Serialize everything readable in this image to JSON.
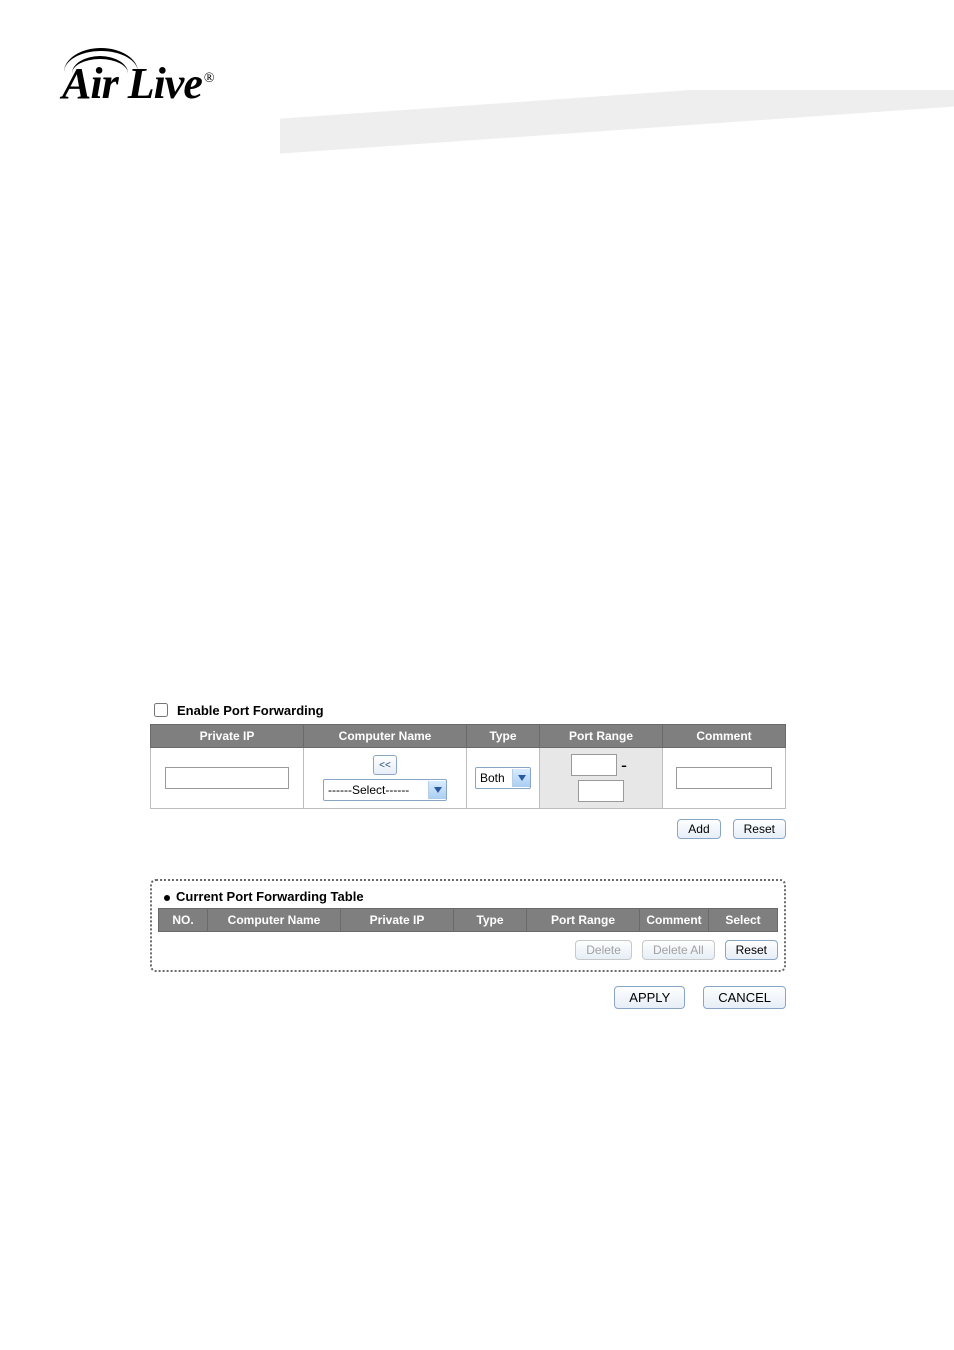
{
  "logo": {
    "text": "Air Live",
    "reg": "®"
  },
  "enable_label": "Enable Port Forwarding",
  "form": {
    "headers": {
      "private_ip": "Private IP",
      "computer_name": "Computer Name",
      "type": "Type",
      "port_range": "Port Range",
      "comment": "Comment"
    },
    "row": {
      "private_ip": "",
      "pick_label": "<<",
      "computer_select_value": "------Select------",
      "type_value": "Both",
      "port_from": "",
      "port_to": "",
      "port_dash": "-",
      "comment": ""
    },
    "buttons": {
      "add": "Add",
      "reset": "Reset"
    }
  },
  "current": {
    "title": "Current Port Forwarding Table",
    "headers": {
      "no": "NO.",
      "computer_name": "Computer Name",
      "private_ip": "Private IP",
      "type": "Type",
      "port_range": "Port Range",
      "comment": "Comment",
      "select": "Select"
    },
    "buttons": {
      "delete": "Delete",
      "delete_all": "Delete All",
      "reset": "Reset"
    }
  },
  "footer_buttons": {
    "apply": "APPLY",
    "cancel": "CANCEL"
  }
}
